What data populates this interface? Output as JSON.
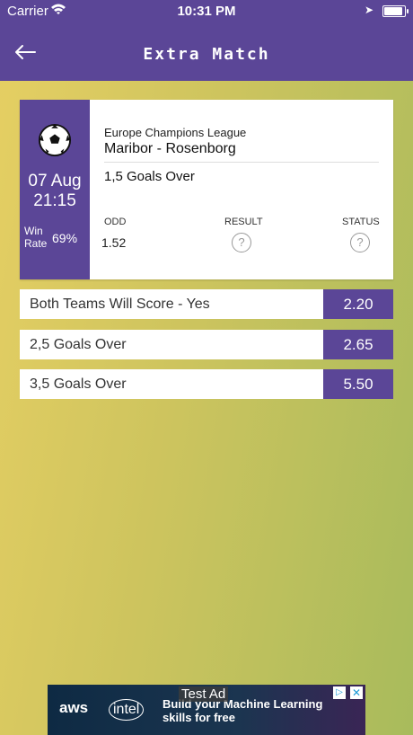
{
  "status_bar": {
    "carrier": "Carrier",
    "time": "10:31 PM",
    "battery_level": 0.9
  },
  "nav": {
    "title": "Extra Match",
    "back_icon": "back-arrow-icon"
  },
  "match": {
    "league": "Europe Champions League",
    "teams": "Maribor - Rosenborg",
    "prediction": "1,5 Goals Over",
    "date": "07 Aug",
    "time": "21:15",
    "win_rate_label": "Win Rate",
    "win_rate": "69%",
    "odd_label": "ODD",
    "result_label": "RESULT",
    "status_label": "STATUS",
    "odd": "1.52",
    "result_icon": "question-icon",
    "status_icon": "question-icon"
  },
  "bets": [
    {
      "label": "Both Teams Will Score - Yes",
      "odd": "2.20"
    },
    {
      "label": "2,5 Goals Over",
      "odd": "2.65"
    },
    {
      "label": "3,5 Goals Over",
      "odd": "5.50"
    }
  ],
  "ad": {
    "badge": "Test Ad",
    "brand1": "aws",
    "brand2": "intel",
    "line1": "Build your Machine Learning",
    "line2": "skills for free"
  },
  "colors": {
    "accent": "#5b4697"
  }
}
